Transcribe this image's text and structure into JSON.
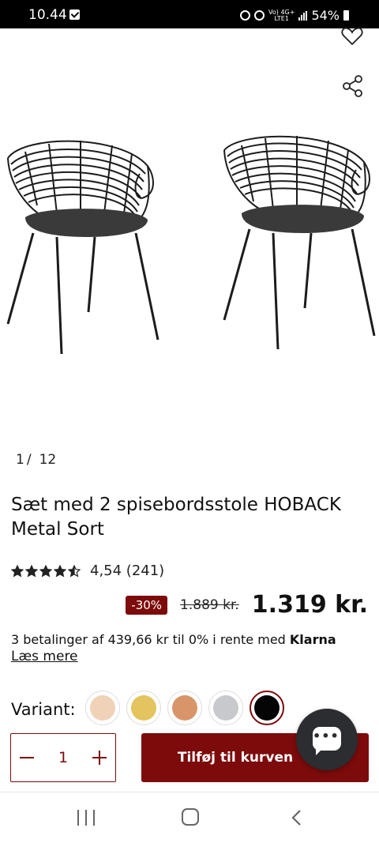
{
  "status_bar": {
    "time": "10.44",
    "network_label": "Vo) 4G+\nLTE1",
    "battery": "54%"
  },
  "gallery": {
    "current": "1",
    "separator": "/",
    "total": "12"
  },
  "product": {
    "title": "Sæt med 2 spisebordsstole HOBACK Metal Sort",
    "rating_value": 4.54,
    "rating_text": "4,54 (241)",
    "stars_total": 5,
    "discount_badge": "-30%",
    "old_price": "1.889 kr.",
    "new_price": "1.319 kr.",
    "klarna_text": "3 betalinger af 439,66 kr til 0% i rente med ",
    "klarna_brand": "Klarna",
    "read_more": "Læs mere"
  },
  "variant": {
    "label": "Variant:",
    "swatches": [
      {
        "name": "light-pink",
        "color": "#efd2b8",
        "selected": false
      },
      {
        "name": "gold",
        "color": "#e3c45e",
        "selected": false
      },
      {
        "name": "copper",
        "color": "#d9956a",
        "selected": false
      },
      {
        "name": "silver",
        "color": "#c7c9cd",
        "selected": false
      },
      {
        "name": "black",
        "color": "#050505",
        "selected": true
      }
    ]
  },
  "cart": {
    "quantity": "1",
    "add_label": "Tilføj til kurven"
  },
  "colors": {
    "accent": "#7d0b0b",
    "chat_fab": "#2b2d30"
  },
  "icons": {
    "heart": "heart-icon",
    "share": "share-icon",
    "chat": "chat-icon"
  }
}
